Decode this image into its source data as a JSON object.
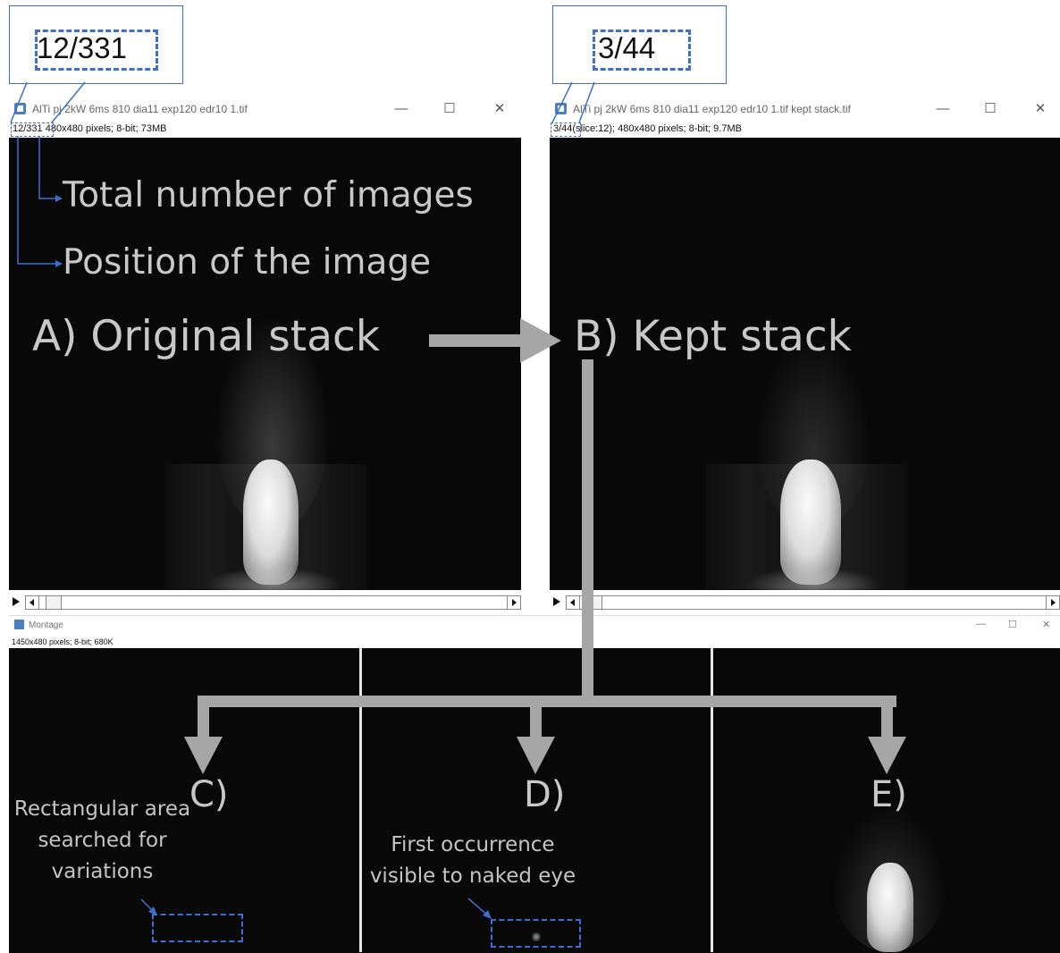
{
  "window_a": {
    "title": "AlTi pj 2kW 6ms 810 dia11 exp120 edr10 1.tif",
    "position": "12/331",
    "info": "480x480 pixels; 8-bit; 73MB"
  },
  "window_b": {
    "title": "AlTi pj 2kW 6ms 810 dia11 exp120 edr10 1.tif kept stack.tif",
    "position": "3/44",
    "info": "(slice:12); 480x480 pixels; 8-bit; 9.7MB"
  },
  "montage": {
    "title": "Montage",
    "info": "1450x480 pixels; 8-bit; 680K"
  },
  "callouts": {
    "a_zoom": "12/331",
    "b_zoom": "3/44"
  },
  "annotations": {
    "total_images": "Total number of images",
    "position_image": "Position of the image",
    "original_stack": "A) Original stack",
    "kept_stack": "B) Kept stack",
    "label_c": "C)",
    "label_d": "D)",
    "label_e": "E)",
    "rect_area_1": "Rectangular area",
    "rect_area_2": "searched for",
    "rect_area_3": "variations",
    "first_occ_1": "First occurrence",
    "first_occ_2": "visible to naked eye"
  },
  "window_controls": {
    "minimize": "—",
    "maximize": "☐",
    "close": "✕"
  },
  "colors": {
    "annotation_blue": "#3b6fd0",
    "arrow_gray": "#a6a6a6",
    "image_background": "#080808"
  }
}
